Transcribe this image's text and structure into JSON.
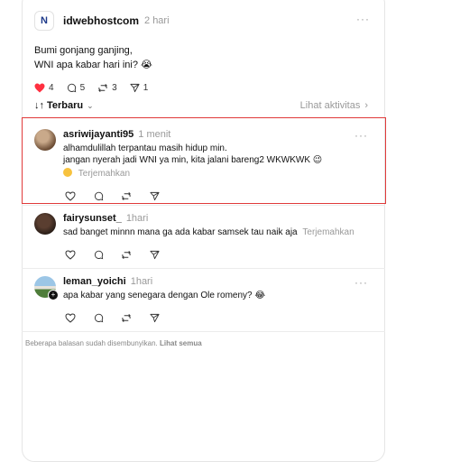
{
  "post": {
    "username": "idwebhostcom",
    "time": "2 hari",
    "more": "···",
    "logo_letter": "N",
    "line1": "Bumi gonjang ganjing,",
    "line2": "WNI apa kabar hari ini? 😭",
    "likes": "4",
    "comments": "5",
    "reposts": "3",
    "shares": "1"
  },
  "sort": {
    "label": "Terbaru",
    "activity": "Lihat aktivitas"
  },
  "replies": [
    {
      "username": "asriwijayanti95",
      "time": "1 menit",
      "line1": "alhamdulillah terpantau masih hidup min.",
      "line2": "jangan nyerah jadi WNI ya min, kita jalani bareng2 WKWKWK 😉",
      "translate": "Terjemahkan",
      "avatar_color": "#8a6a4f"
    },
    {
      "username": "fairysunset_",
      "time": "1hari",
      "line1": "sad banget minnn mana ga ada kabar samsek tau naik aja",
      "translate": "Terjemahkan",
      "avatar_color": "#3a2a20"
    },
    {
      "username": "leman_yoichi",
      "time": "1hari",
      "line1": "apa kabar yang senegara dengan Ole romeny? 😂",
      "avatar_color": "#6fa0c8"
    }
  ],
  "hidden_note": {
    "text": "Beberapa balasan sudah disembunyikan.",
    "link": "Lihat semua"
  },
  "colors": {
    "like": "#ff3040",
    "highlight": "#e03a3a"
  }
}
